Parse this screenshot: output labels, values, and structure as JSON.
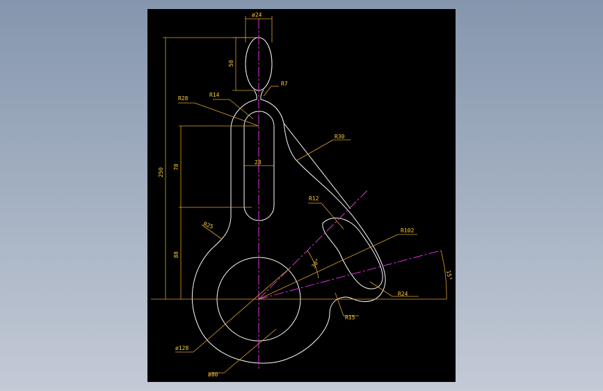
{
  "drawing": {
    "background": "#000000",
    "geometry_color": "#ffffff",
    "dimension_color": "#ffcc33",
    "centerline_color": "#e032e0",
    "labels": {
      "d24": "ø24",
      "d50": "50",
      "r7": "R7",
      "r14": "R14",
      "r28": "R28",
      "r30": "R30",
      "d28": "28",
      "d78": "78",
      "d250": "250",
      "r12": "R12",
      "r102": "R102",
      "r25": "R25",
      "d30deg": "30°",
      "d88": "88",
      "d15deg": "15°",
      "r24": "R24",
      "r15": "R15",
      "d128": "ø128",
      "d80": "ø80"
    }
  }
}
